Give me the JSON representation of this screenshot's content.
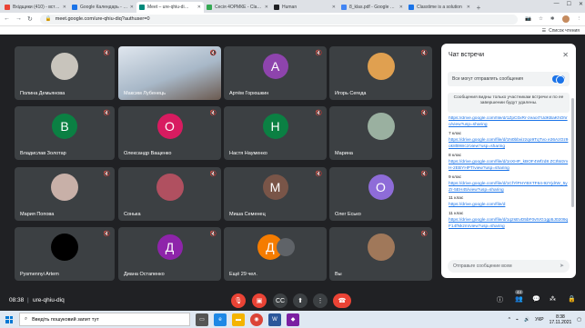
{
  "browser": {
    "tabs": [
      {
        "label": "Вхідщики (410) - вст…",
        "color": "#ea4335"
      },
      {
        "label": "Google Календарь - ла…",
        "color": "#1a73e8"
      },
      {
        "label": "Meet – ure-qhiu-di…",
        "color": "#00897b"
      },
      {
        "label": "Сесія 4ОРМКЕ - Clas…",
        "color": "#34a853"
      },
      {
        "label": "Human",
        "color": "#202124"
      },
      {
        "label": "8_klas.pdf - Google Д…",
        "color": "#4285f4"
      },
      {
        "label": "Classtime is a solution",
        "color": "#1a73e8"
      }
    ],
    "url": "meet.google.com/ure-qhiu-diq?authuser=0",
    "reading_list": "Список чтения"
  },
  "participants": [
    {
      "name": "Полина Демьянова",
      "kind": "photo",
      "color": "#c8c4bc"
    },
    {
      "name": "Максим Лубенець",
      "kind": "video",
      "color": "#a8b8c8"
    },
    {
      "name": "Артём Горюшкин",
      "kind": "letter",
      "letter": "A",
      "color": "#8e44ad"
    },
    {
      "name": "Игорь Сегеда",
      "kind": "photo",
      "color": "#e0a050"
    },
    {
      "name": "Владислав Золотар",
      "kind": "letter",
      "letter": "В",
      "color": "#0b8043"
    },
    {
      "name": "Олександр Ващенко",
      "kind": "letter",
      "letter": "О",
      "color": "#d81b60"
    },
    {
      "name": "Настя Науменко",
      "kind": "letter",
      "letter": "Н",
      "color": "#0b8043"
    },
    {
      "name": "Марина",
      "kind": "photo",
      "color": "#9ab0a0"
    },
    {
      "name": "Мария Попова",
      "kind": "photo",
      "color": "#c8b0a8"
    },
    {
      "name": "Сонька",
      "kind": "photo",
      "color": "#b05060"
    },
    {
      "name": "Миша Семенец",
      "kind": "letter",
      "letter": "М",
      "color": "#795548"
    },
    {
      "name": "Олег Есько",
      "kind": "letter",
      "letter": "О",
      "color": "#8e6cd8"
    },
    {
      "name": "Pysmennyi Artem",
      "kind": "photo",
      "color": "#000000"
    },
    {
      "name": "Диана Остапенко",
      "kind": "letter",
      "letter": "Д",
      "color": "#8e24aa"
    },
    {
      "name": "Ещё 29 чел.",
      "kind": "group",
      "letter": "Д",
      "color": "#f57c00"
    },
    {
      "name": "Вы",
      "kind": "photo",
      "color": "#a0785a"
    }
  ],
  "chat": {
    "title": "Чат встречи",
    "toggle_label": "Все могут отправлять сообщения",
    "notice": "Сообщения видны только участникам встречи и по ее завершении будут удалены.",
    "messages": [
      {
        "label": "",
        "link": "https://drive.google.com/file/d/1ZpC0xRr-zeaoI7UdKBaKhOhro/view?usp=sharing"
      },
      {
        "label": "7 клас",
        "link": "https://drive.google.com/file/d/1N0bbvizzqo9TqTvo e26AzOz9ok8lt9Wcz/view?usp=sharing"
      },
      {
        "label": "8 клас",
        "link": "https://drive.google.com/file/d/1nXHP_kBOF4Wfzd8 ZCIlWzmH-2EBYHPT/view?usp=sharing"
      },
      {
        "label": "9 клас",
        "link": "https://drive.google.com/file/d/1CfYlPHYBXTF64-92YjdrW_5yZr-5EH45/view?usp=sharing"
      },
      {
        "label": "11 клас",
        "link": "https://drive.google.com/file/d"
      },
      {
        "label": "11 клас",
        "link": "https://drive.google.com/file/d/1q2sEvD5bF0vtVG1gp5J0209qF14fNkzm/view?usp=sharing"
      }
    ],
    "input_placeholder": "Отправьте сообщение всем"
  },
  "bottom": {
    "time": "08:38",
    "separator": "|",
    "code": "ure-qhiu-diq",
    "participant_count": "44"
  },
  "taskbar": {
    "search_placeholder": "Введіть пошуковий запит тут",
    "lang": "УКР",
    "time": "8:38",
    "date": "17.11.2021"
  }
}
